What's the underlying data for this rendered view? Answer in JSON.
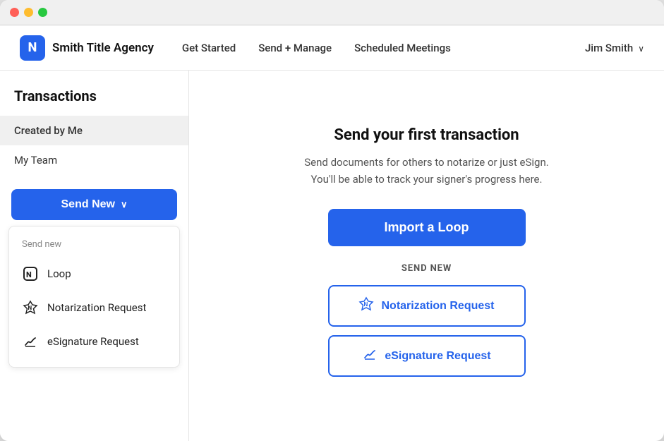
{
  "window": {
    "titlebar": {
      "lights": [
        "red",
        "yellow",
        "green"
      ]
    }
  },
  "topnav": {
    "brand_logo": "N",
    "brand_name": "Smith Title Agency",
    "nav": [
      {
        "label": "Get Started",
        "id": "get-started"
      },
      {
        "label": "Send + Manage",
        "id": "send-manage"
      },
      {
        "label": "Scheduled Meetings",
        "id": "scheduled-meetings"
      }
    ],
    "user_name": "Jim Smith",
    "user_chevron": "chevron"
  },
  "sidebar": {
    "title": "Transactions",
    "items": [
      {
        "label": "Created by Me",
        "active": true
      },
      {
        "label": "My Team",
        "active": false
      }
    ],
    "send_new_btn": "Send New",
    "dropdown": {
      "label": "Send new",
      "items": [
        {
          "icon": "loop",
          "label": "Loop"
        },
        {
          "icon": "notarization",
          "label": "Notarization Request"
        },
        {
          "icon": "esignature",
          "label": "eSignature Request"
        }
      ]
    }
  },
  "main": {
    "heading": "Send your first transaction",
    "subtext_line1": "Send documents for others to notarize or just eSign.",
    "subtext_line2": "You'll be able to track your signer's progress here.",
    "import_loop_btn": "Import a Loop",
    "send_new_section_label": "SEND NEW",
    "action_buttons": [
      {
        "icon": "notarization",
        "label": "Notarization Request"
      },
      {
        "icon": "esignature",
        "label": "eSignature Request"
      }
    ]
  }
}
